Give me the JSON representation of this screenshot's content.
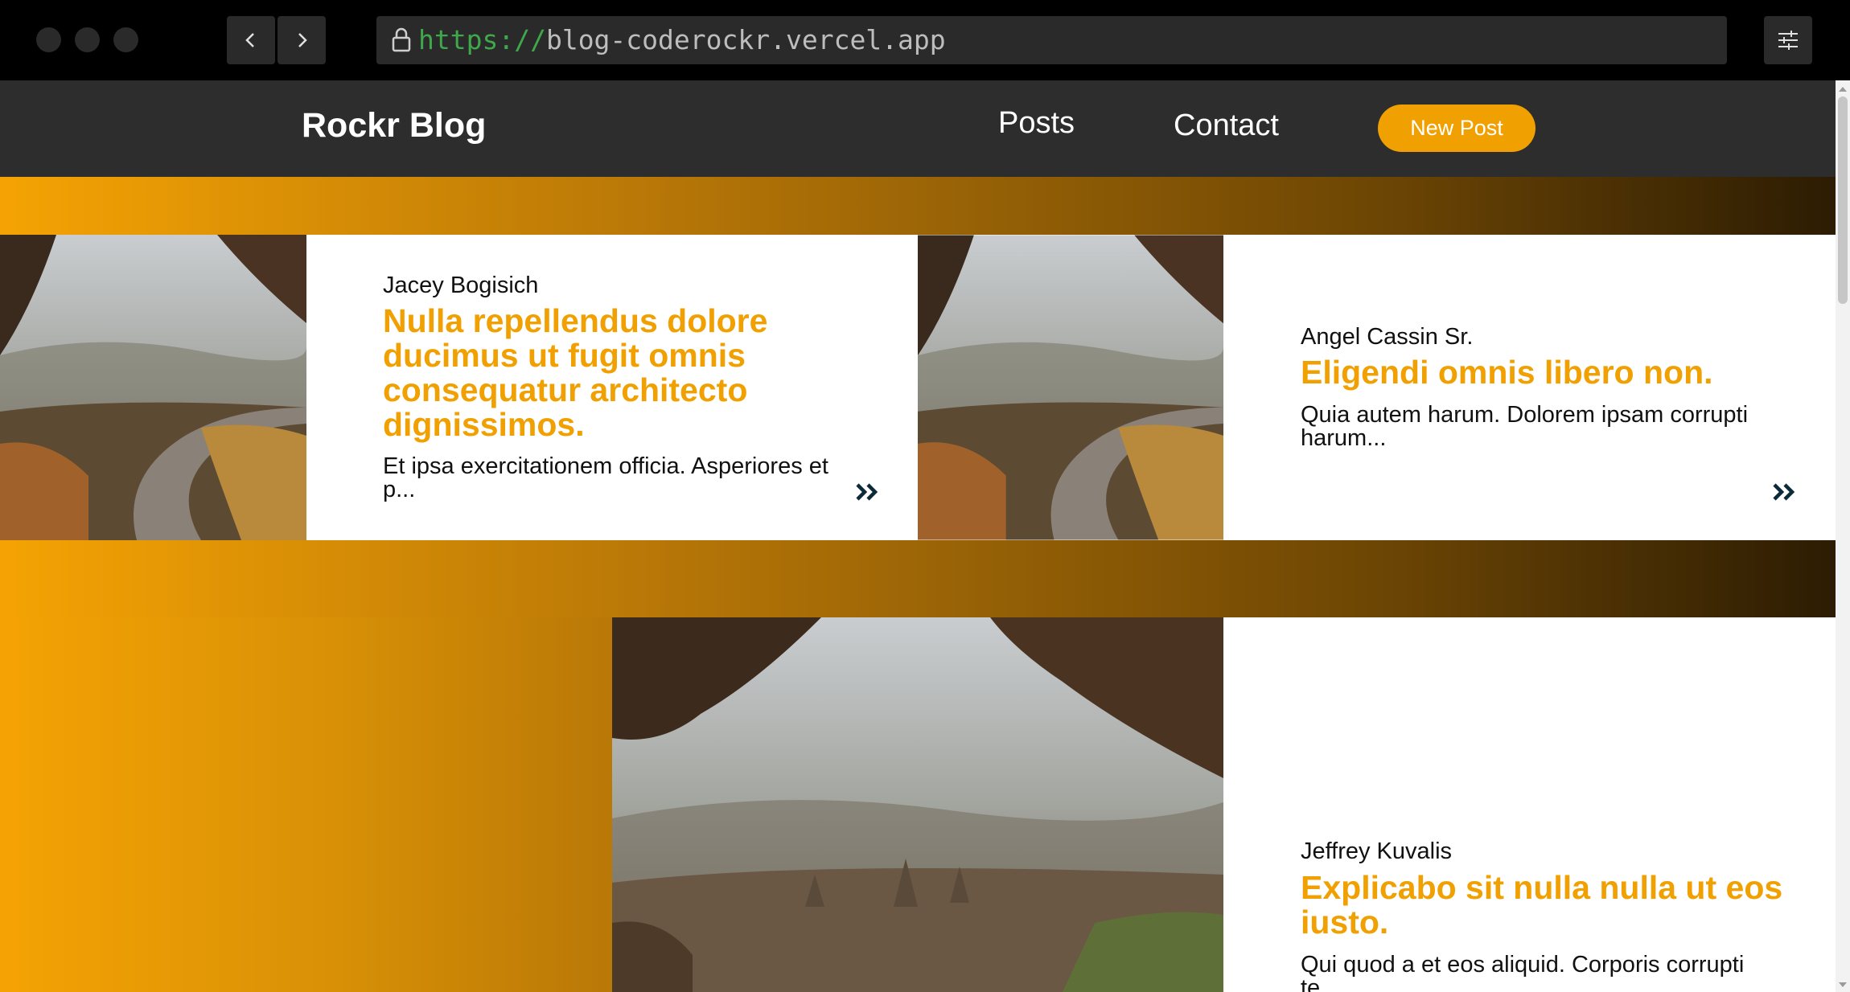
{
  "browser": {
    "url_scheme": "https://",
    "url_host": "blog-coderockr.vercel.app",
    "icons": [
      "lock-icon",
      "chevron-left-icon",
      "chevron-right-icon",
      "sliders-icon"
    ]
  },
  "site": {
    "brand": "Rockr Blog",
    "nav": [
      "Posts",
      "Contact"
    ],
    "new_post": "New Post",
    "accent_color": "#f0a000",
    "header_color": "#2d2d2d"
  },
  "posts": [
    {
      "author": "Jacey Bogisich",
      "title": "Nulla repellendus dolore ducimus ut fugit omnis consequatur architecto dignissimos.",
      "excerpt": "Et ipsa exercitationem officia. Asperiores et p..."
    },
    {
      "author": "Angel Cassin Sr.",
      "title": "Eligendi omnis libero non.",
      "excerpt": "Quia autem harum. Dolorem ipsam corrupti harum..."
    },
    {
      "author": "Jeffrey Kuvalis",
      "title": "Explicabo sit nulla nulla ut eos iusto.",
      "excerpt": "Qui quod a et eos aliquid. Corporis corrupti te..."
    }
  ]
}
